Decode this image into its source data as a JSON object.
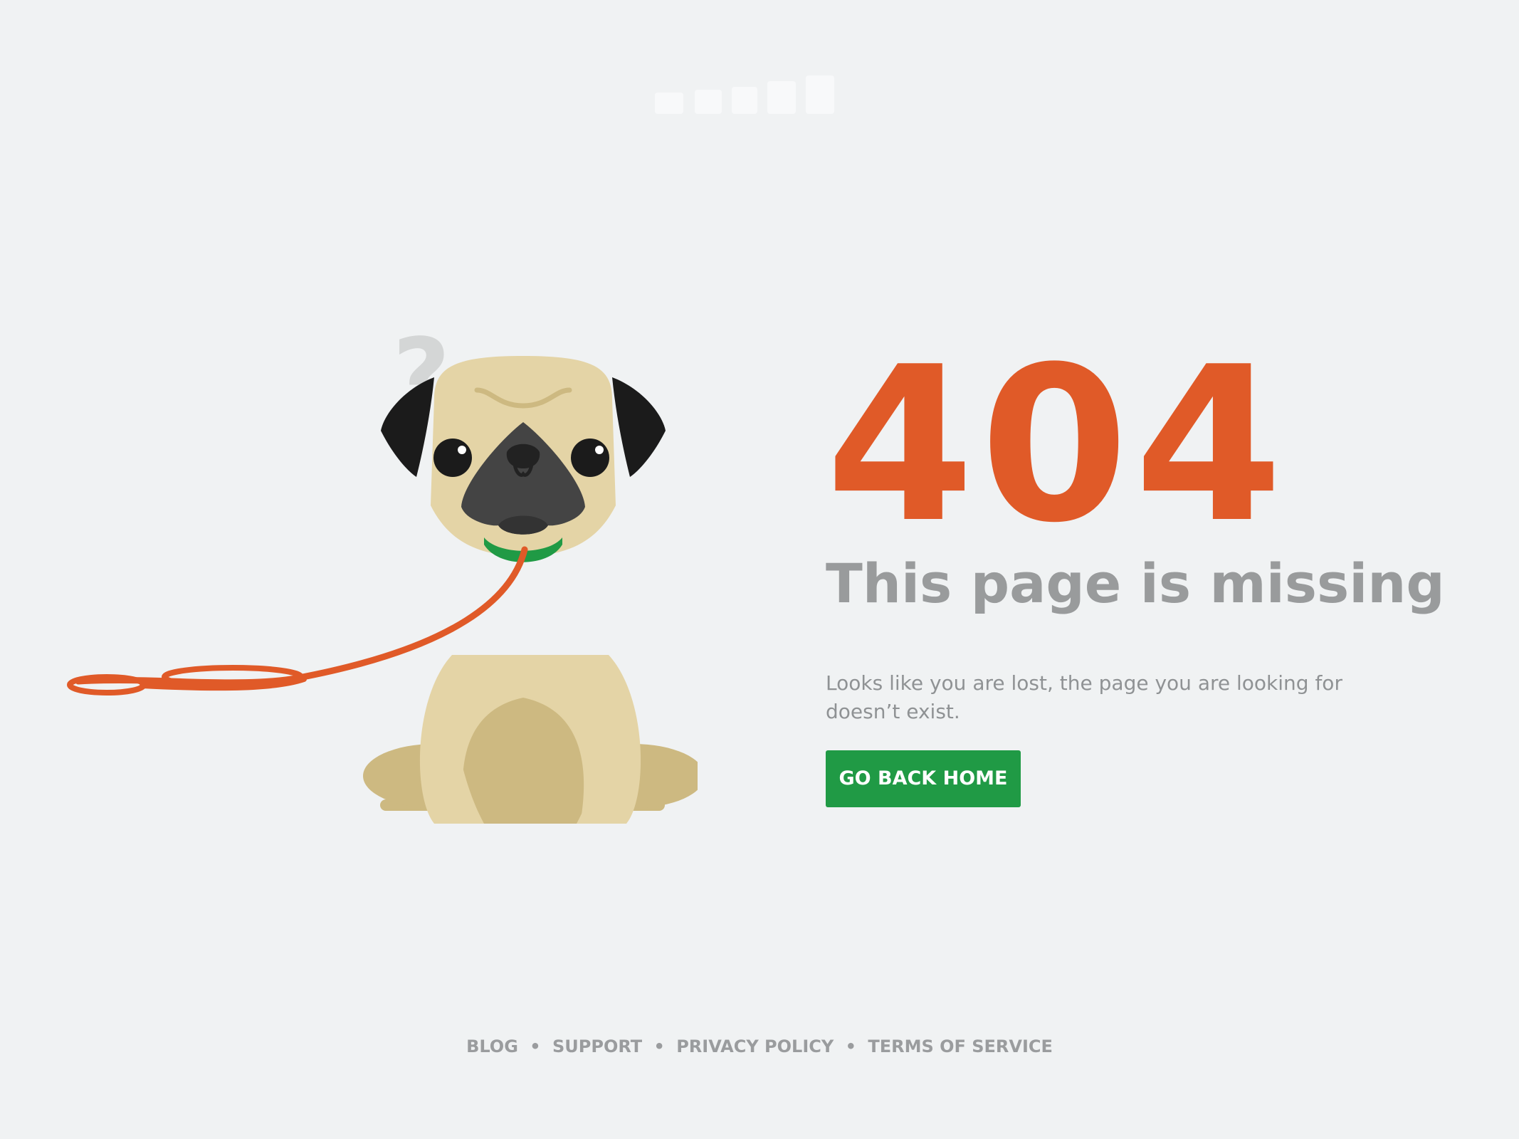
{
  "error": {
    "code": "404",
    "title": "This page is missing",
    "description": "Looks like you are lost, the page you are looking for doesn’t exist.",
    "button_label": "GO BACK HOME"
  },
  "footer": {
    "links": [
      "BLOG",
      "SUPPORT",
      "PRIVACY POLICY",
      "TERMS OF SERVICE"
    ],
    "separator": "•"
  },
  "illustration": {
    "question_marks": [
      "?",
      "?",
      "?"
    ]
  },
  "colors": {
    "background": "#f0f2f3",
    "accent_orange": "#e05a28",
    "heading_gray": "#999b9c",
    "button_green": "#209a45",
    "pug_fawn": "#e4d4a6",
    "pug_shadow": "#cdb981"
  }
}
